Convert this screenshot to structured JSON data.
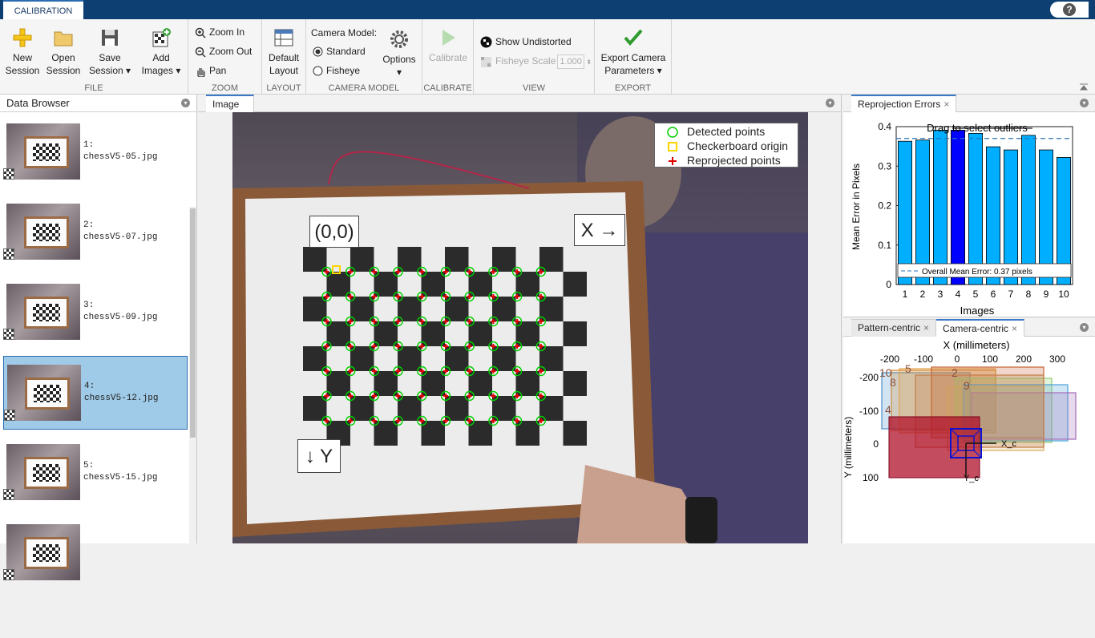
{
  "app": {
    "tab": "CALIBRATION",
    "help": "?"
  },
  "ribbon": {
    "file": {
      "label": "FILE",
      "new_session": [
        "New",
        "Session"
      ],
      "open_session": [
        "Open",
        "Session"
      ],
      "save_session": [
        "Save",
        "Session"
      ],
      "add_images": [
        "Add",
        "Images"
      ]
    },
    "zoom": {
      "label": "ZOOM",
      "zoom_in": "Zoom In",
      "zoom_out": "Zoom Out",
      "pan": "Pan"
    },
    "layout": {
      "label": "LAYOUT",
      "default_layout": [
        "Default",
        "Layout"
      ]
    },
    "camera_model": {
      "label": "CAMERA MODEL",
      "title": "Camera Model:",
      "standard": "Standard",
      "fisheye": "Fisheye",
      "options": "Options",
      "selected": "Standard"
    },
    "calibrate": {
      "label": "CALIBRATE",
      "button": "Calibrate"
    },
    "view": {
      "label": "VIEW",
      "show_undistorted": "Show Undistorted",
      "fisheye_scale": "Fisheye Scale",
      "fisheye_scale_value": "1.000"
    },
    "export": {
      "label": "EXPORT",
      "button": [
        "Export Camera",
        "Parameters"
      ]
    }
  },
  "data_browser": {
    "title": "Data Browser",
    "items": [
      {
        "index": "1:",
        "file": "chessV5-05.jpg",
        "selected": false
      },
      {
        "index": "2:",
        "file": "chessV5-07.jpg",
        "selected": false
      },
      {
        "index": "3:",
        "file": "chessV5-09.jpg",
        "selected": false
      },
      {
        "index": "4:",
        "file": "chessV5-12.jpg",
        "selected": true
      },
      {
        "index": "5:",
        "file": "chessV5-15.jpg",
        "selected": false
      },
      {
        "index": "",
        "file": "",
        "selected": false
      }
    ]
  },
  "image_panel": {
    "tab": "Image",
    "origin_label": "(0,0)",
    "x_label": "X →",
    "y_label": "↓ Y",
    "legend": [
      "Detected points",
      "Checkerboard origin",
      "Reprojected points"
    ]
  },
  "reprojection": {
    "tab": "Reprojection Errors",
    "close": "×"
  },
  "extrinsics": {
    "tabs": [
      {
        "label": "Pattern-centric",
        "close": "×"
      },
      {
        "label": "Camera-centric",
        "close": "×"
      }
    ],
    "active": "Camera-centric",
    "x_title": "X (millimeters)",
    "y_title": "Y (millimeters)",
    "x_ticks": [
      "-200",
      "-100",
      "0",
      "100",
      "200",
      "300"
    ],
    "y_ticks": [
      "-200",
      "-100",
      "0",
      "100"
    ],
    "axis_labels": [
      "X_c",
      "Y_c"
    ],
    "overlay_numbers": [
      "10",
      "5",
      "2",
      "8",
      "4",
      "9"
    ]
  },
  "chart_data": {
    "type": "bar",
    "title": "Drag to select outliers",
    "xlabel": "Images",
    "ylabel": "Mean Error in Pixels",
    "categories": [
      "1",
      "2",
      "3",
      "4",
      "5",
      "6",
      "7",
      "8",
      "9",
      "10"
    ],
    "values": [
      0.363,
      0.366,
      0.391,
      0.391,
      0.383,
      0.349,
      0.341,
      0.378,
      0.341,
      0.322
    ],
    "highlight_index": 3,
    "ylim": [
      0,
      0.4
    ],
    "yticks": [
      "0",
      "0.1",
      "0.2",
      "0.3",
      "0.4"
    ],
    "mean_line": 0.37,
    "legend": "Overall Mean Error: 0.37 pixels",
    "colors": {
      "bar": "#00aeff",
      "selected": "#0000ff",
      "mean": "#2a74b8"
    }
  }
}
